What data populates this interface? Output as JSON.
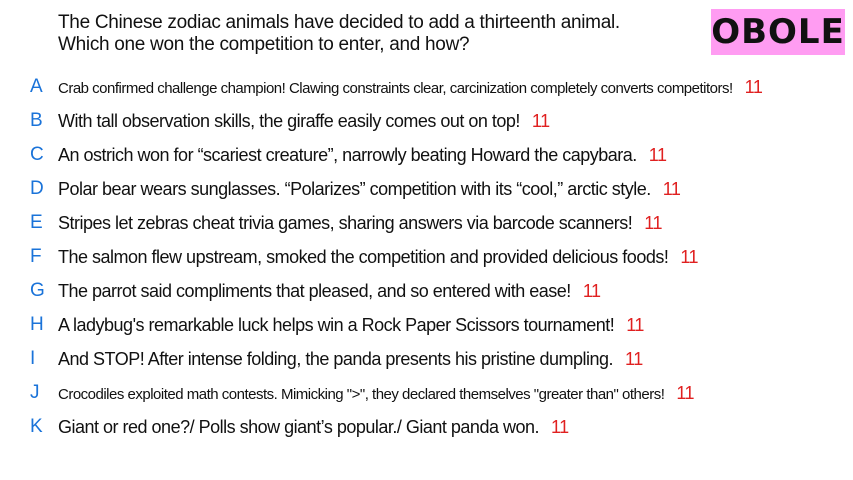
{
  "colors": {
    "letter": "#1a73d9",
    "count": "#e02020",
    "badge_bg": "#ff9cf2",
    "text": "#111111"
  },
  "question": {
    "line1": "The Chinese zodiac animals have decided to add a thirteenth animal.",
    "line2": "Which one won the competition to enter, and how?"
  },
  "badge": "OBOLE",
  "options": [
    {
      "letter": "A",
      "text": "Crab confirmed challenge champion! Clawing constraints clear, carcinization completely converts competitors!",
      "count": "11"
    },
    {
      "letter": "B",
      "text": "With tall observation skills, the giraffe easily comes out on top!",
      "count": "11"
    },
    {
      "letter": "C",
      "text": "An ostrich won for “scariest creature”, narrowly beating Howard the capybara.",
      "count": "11"
    },
    {
      "letter": "D",
      "text": "Polar bear wears sunglasses. “Polarizes” competition with its “cool,” arctic style.",
      "count": "11"
    },
    {
      "letter": "E",
      "text": "Stripes let zebras cheat trivia games, sharing answers via barcode scanners!",
      "count": "11"
    },
    {
      "letter": "F",
      "text": "The salmon flew upstream, smoked the competition and provided delicious foods!",
      "count": "11"
    },
    {
      "letter": "G",
      "text": "The parrot said compliments that pleased, and so entered with ease!",
      "count": "11"
    },
    {
      "letter": "H",
      "text": "A ladybug's remarkable luck helps win a Rock Paper Scissors tournament!",
      "count": "11"
    },
    {
      "letter": "I",
      "text": "And STOP! After intense folding, the panda presents his pristine dumpling.",
      "count": "11"
    },
    {
      "letter": "J",
      "text": "Crocodiles exploited math contests. Mimicking \">\", they declared themselves \"greater than\" others!",
      "count": "11"
    },
    {
      "letter": "K",
      "text": "Giant or red one?/ Polls show giant’s popular./ Giant panda won.",
      "count": "11"
    }
  ]
}
